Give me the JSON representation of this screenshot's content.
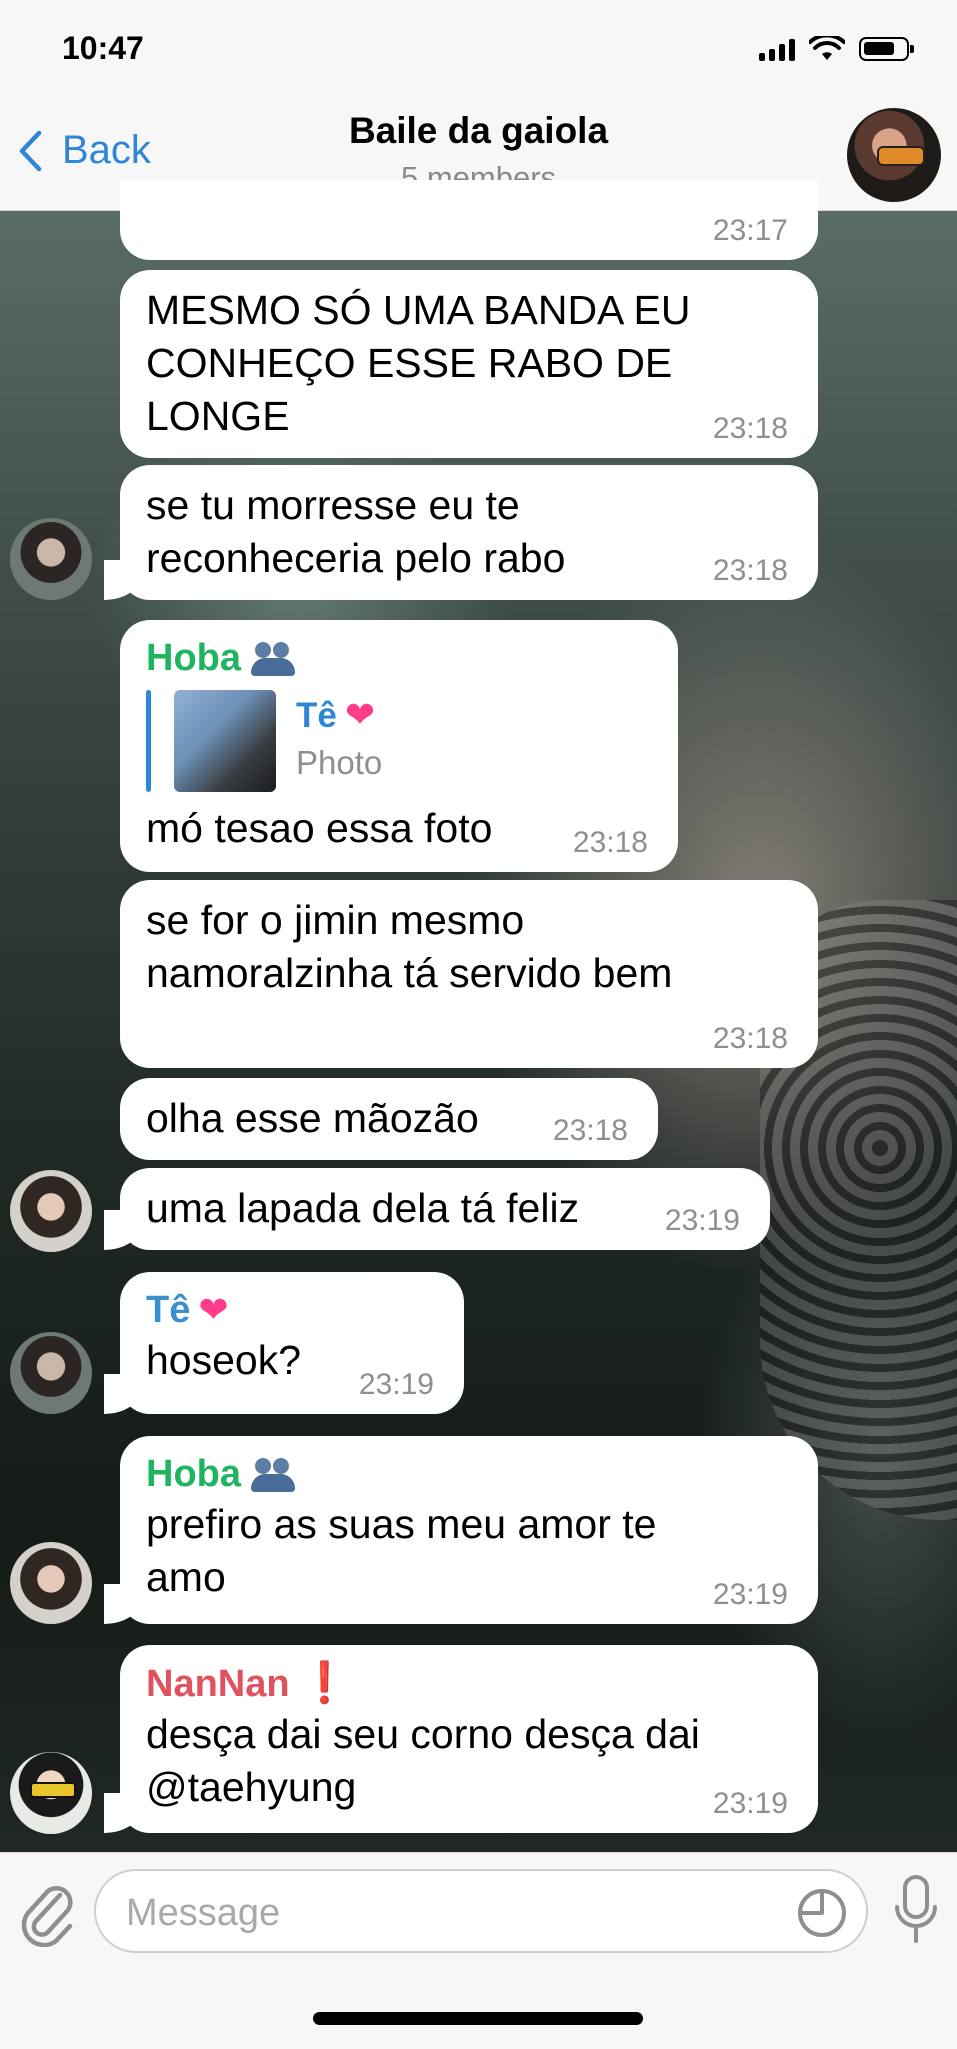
{
  "status_bar": {
    "time": "10:47"
  },
  "header": {
    "back_label": "Back",
    "title": "Baile da gaiola",
    "subtitle": "5 members"
  },
  "messages": [
    {
      "text": "",
      "time": "23:17"
    },
    {
      "text": "MESMO SÓ UMA BANDA EU CONHEÇO ESSE RABO DE LONGE",
      "time": "23:18"
    },
    {
      "text": "se tu morresse eu te reconheceria pelo rabo",
      "time": "23:18"
    },
    {
      "sender": "Hoba",
      "reply_to": {
        "name": "Tê",
        "type": "Photo"
      },
      "text": "mó tesao essa foto",
      "time": "23:18"
    },
    {
      "text": "se for o jimin mesmo namoralzinha tá servido bem",
      "time": "23:18"
    },
    {
      "text": "olha esse mãozão",
      "time": "23:18"
    },
    {
      "text": "uma lapada dela tá feliz",
      "time": "23:19"
    },
    {
      "sender": "Tê",
      "text": "hoseok?",
      "time": "23:19"
    },
    {
      "sender": "Hoba",
      "text": "prefiro as suas meu amor te amo",
      "time": "23:19"
    },
    {
      "sender": "NanNan",
      "text": "desça dai seu corno desça dai @taehyung",
      "time": "23:19"
    }
  ],
  "composer": {
    "placeholder": "Message"
  },
  "colors": {
    "accent": "#2f86d6",
    "sender_hoba": "#1fb55f",
    "sender_te": "#3a8fcf",
    "sender_nannan": "#e0525e"
  }
}
